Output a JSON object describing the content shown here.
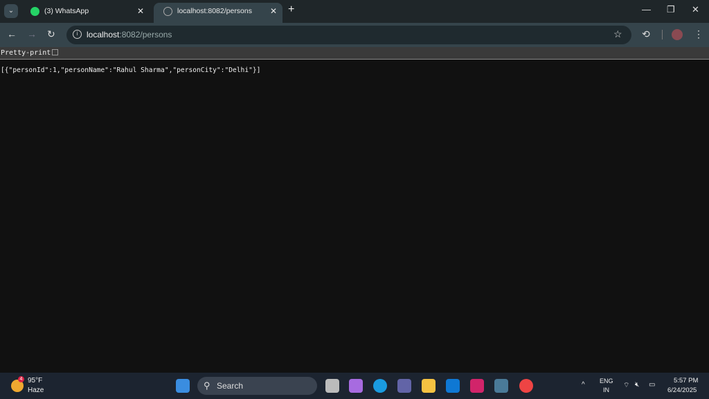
{
  "tabs": [
    {
      "label": "(3) WhatsApp",
      "icon": "whatsapp-icon",
      "active": false
    },
    {
      "label": "localhost:8082/persons",
      "icon": "globe-icon",
      "active": true
    }
  ],
  "address": {
    "host": "localhost",
    "rest": ":8082/persons"
  },
  "viewer": {
    "pretty_print_label": "Pretty-print",
    "pretty_print_checked": false
  },
  "content": "[{\"personId\":1,\"personName\":\"Rahul Sharma\",\"personCity\":\"Delhi\"}]",
  "taskbar": {
    "weather_temp": "95°F",
    "weather_desc": "Haze",
    "weather_badge": "4",
    "search_label": "Search",
    "lang": "ENG",
    "region": "IN",
    "time": "5:57 PM",
    "date": "6/24/2025"
  }
}
